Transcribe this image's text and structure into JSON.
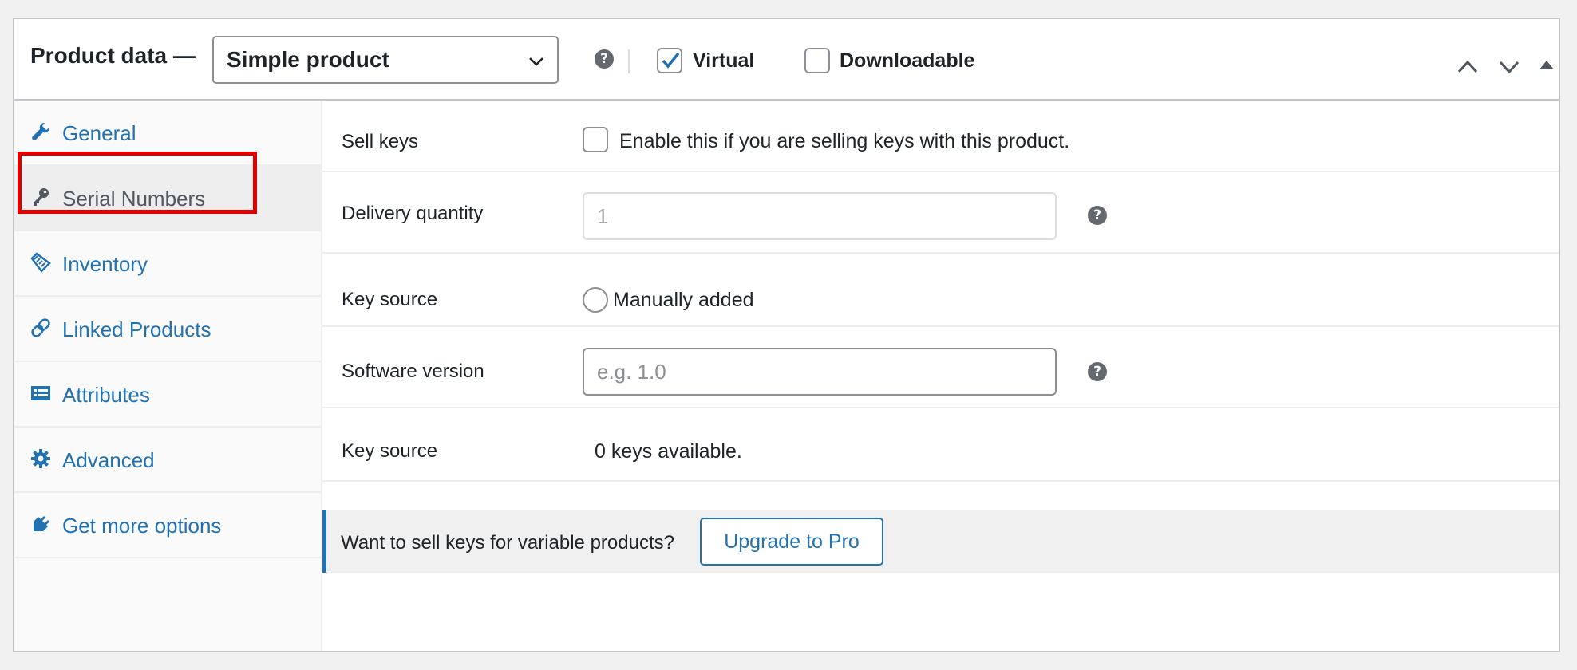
{
  "header": {
    "title": "Product data —",
    "product_type": "Simple product",
    "help_glyph": "?",
    "virtual_label": "Virtual",
    "virtual_checked": true,
    "downloadable_label": "Downloadable",
    "downloadable_checked": false
  },
  "sidebar": {
    "tabs": [
      {
        "label": "General",
        "icon": "wrench-icon"
      },
      {
        "label": "Serial Numbers",
        "icon": "key-icon",
        "active": true
      },
      {
        "label": "Inventory",
        "icon": "tag-icon"
      },
      {
        "label": "Linked Products",
        "icon": "link-icon"
      },
      {
        "label": "Attributes",
        "icon": "list-icon"
      },
      {
        "label": "Advanced",
        "icon": "gear-icon"
      },
      {
        "label": "Get more options",
        "icon": "plugin-icon"
      }
    ]
  },
  "fields": {
    "sell_keys": {
      "label": "Sell keys",
      "checkbox_text": "Enable this if you are selling keys with this product."
    },
    "delivery_quantity": {
      "label": "Delivery quantity",
      "placeholder": "1"
    },
    "key_source_1": {
      "label": "Key source",
      "option": "Manually added"
    },
    "software_version": {
      "label": "Software version",
      "placeholder": "e.g. 1.0"
    },
    "key_source_2": {
      "label": "Key source",
      "value": "0 keys available."
    }
  },
  "notice": {
    "message": "Want to sell keys for variable products?",
    "button": "Upgrade to Pro"
  },
  "colors": {
    "accent": "#2271b1",
    "highlight": "#e00000"
  }
}
